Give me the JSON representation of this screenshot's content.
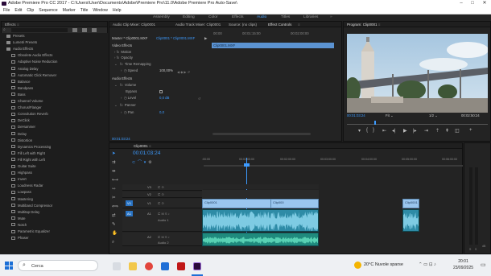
{
  "window": {
    "title": "Adobe Premiere Pro CC 2017 - C:\\Users\\User\\Documents\\Adobe\\Premiere Pro\\11.0\\Adobe Premiere Pro Auto-Save\\"
  },
  "menu": [
    "File",
    "Edit",
    "Clip",
    "Sequence",
    "Marker",
    "Title",
    "Window",
    "Help"
  ],
  "workspaces": [
    "Assembly",
    "Editing",
    "Color",
    "Effects",
    "Audio",
    "Titles",
    "Libraries"
  ],
  "active_workspace": "Audio",
  "left_panel": {
    "tab": "Effects",
    "project_label": "Project:",
    "items": [
      {
        "label": "Presets",
        "kind": "folder"
      },
      {
        "label": "Lumetri Presets",
        "kind": "folder"
      },
      {
        "label": "Audio Effects",
        "kind": "folder"
      },
      {
        "label": "Obsolete Audio Effects",
        "kind": "fx"
      },
      {
        "label": "Adaptive Noise Reduction",
        "kind": "fx"
      },
      {
        "label": "Analog Delay",
        "kind": "fx"
      },
      {
        "label": "Automatic Click Remover",
        "kind": "fx"
      },
      {
        "label": "Balance",
        "kind": "fx"
      },
      {
        "label": "Bandpass",
        "kind": "fx"
      },
      {
        "label": "Bass",
        "kind": "fx"
      },
      {
        "label": "Channel Volume",
        "kind": "fx"
      },
      {
        "label": "Chorus/Flanger",
        "kind": "fx"
      },
      {
        "label": "Convolution Reverb",
        "kind": "fx"
      },
      {
        "label": "DeClick",
        "kind": "fx"
      },
      {
        "label": "DeHummer",
        "kind": "fx"
      },
      {
        "label": "Delay",
        "kind": "fx"
      },
      {
        "label": "Distortion",
        "kind": "fx"
      },
      {
        "label": "Dynamics Processing",
        "kind": "fx"
      },
      {
        "label": "Fill Left with Right",
        "kind": "fx"
      },
      {
        "label": "Fill Right with Left",
        "kind": "fx"
      },
      {
        "label": "Guitar Suite",
        "kind": "fx"
      },
      {
        "label": "Highpass",
        "kind": "fx"
      },
      {
        "label": "Invert",
        "kind": "fx"
      },
      {
        "label": "Loudness Radar",
        "kind": "fx"
      },
      {
        "label": "Lowpass",
        "kind": "fx"
      },
      {
        "label": "Mastering",
        "kind": "fx"
      },
      {
        "label": "Multiband Compressor",
        "kind": "fx"
      },
      {
        "label": "Multitap Delay",
        "kind": "fx"
      },
      {
        "label": "Mute",
        "kind": "fx"
      },
      {
        "label": "Notch",
        "kind": "fx"
      },
      {
        "label": "Parametric Equalizer",
        "kind": "fx"
      },
      {
        "label": "Phaser",
        "kind": "fx"
      }
    ]
  },
  "effect_controls": {
    "tabs": [
      "Audio Clip Mixer: Clip0001",
      "Audio Track Mixer: Clip0001",
      "Source: (no clips)",
      "Effect Controls"
    ],
    "master": "Master * Clip0001.MXF",
    "clip_link": "Clip0001 * Clip0001.MXF",
    "ruler": [
      "00:00",
      "00:01:15:00",
      "00:02:00:00"
    ],
    "clip_bar": "Clip0001.MXF",
    "video_effects": "Video Effects",
    "motion": "Motion",
    "opacity": "Opacity",
    "time_remap": "Time Remapping",
    "speed_label": "Speed",
    "speed_value": "100,00%",
    "audio_effects": "Audio Effects",
    "volume": "Volume",
    "bypass": "Bypass",
    "level_label": "Level",
    "level_value": "0,0 dB",
    "panner": "Panner",
    "pan_label": "Pan",
    "pan_value": "0,0",
    "timecode": "00:01:03:24"
  },
  "program_monitor": {
    "tab": "Program: Clip0001",
    "timecode": "00:01:03:24",
    "fit": "Fit",
    "fraction": "1/2",
    "duration": "00:02:50:24"
  },
  "timeline": {
    "tab": "Clip0001",
    "timecode": "00:01:03:24",
    "ruler": [
      ":00:00",
      "00:01:00:00",
      "00:02:00:00",
      "00:03:00:00",
      "00:04:00:00",
      "00:05:00:00",
      "00:06:00:00"
    ],
    "tracks_video": [
      "V3",
      "V2",
      "V1"
    ],
    "tracks_audio": [
      "A1",
      "A2"
    ],
    "audio1_label": "Audio 1",
    "audio2_label": "Audio 2",
    "clip_labels": [
      "Clip0001",
      "Clip000",
      "Clip0001"
    ],
    "meter_labels": [
      "dB",
      "S",
      "S"
    ]
  },
  "taskbar": {
    "search": "Cerca",
    "weather": "20°C  Nuvole sparse",
    "time": "20:01",
    "date": "23/09/2025"
  }
}
